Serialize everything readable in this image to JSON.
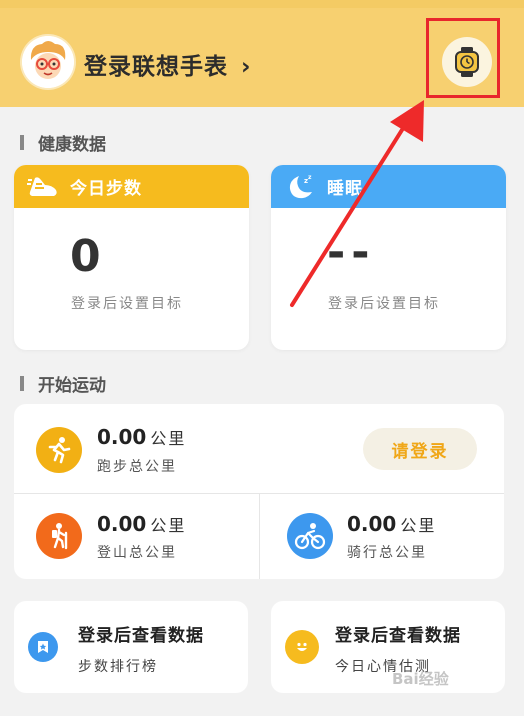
{
  "header": {
    "title": "登录联想手表",
    "chevron": "›",
    "watch_icon": "watch-icon",
    "bg_color": "#f7d070"
  },
  "health_section": {
    "title": "健康数据",
    "steps_card": {
      "title": "今日步数",
      "value": "0",
      "hint": "登录后设置目标",
      "color": "#f6bb1e"
    },
    "sleep_card": {
      "title": "睡眠",
      "value": "--",
      "hint": "登录后设置目标",
      "color": "#4aaaf5"
    }
  },
  "sport_section": {
    "title": "开始运动",
    "login_button": "请登录",
    "running": {
      "value": "0.00",
      "unit": "公里",
      "label": "跑步总公里"
    },
    "hiking": {
      "value": "0.00",
      "unit": "公里",
      "label": "登山总公里"
    },
    "cycling": {
      "value": "0.00",
      "unit": "公里",
      "label": "骑行总公里"
    }
  },
  "bottom_cards": [
    {
      "title": "登录后查看数据",
      "subtitle": "步数排行榜",
      "icon": "badge-icon"
    },
    {
      "title": "登录后查看数据",
      "subtitle": "今日心情估测",
      "icon": "smiley-icon"
    }
  ],
  "watermark": "Bai经验"
}
